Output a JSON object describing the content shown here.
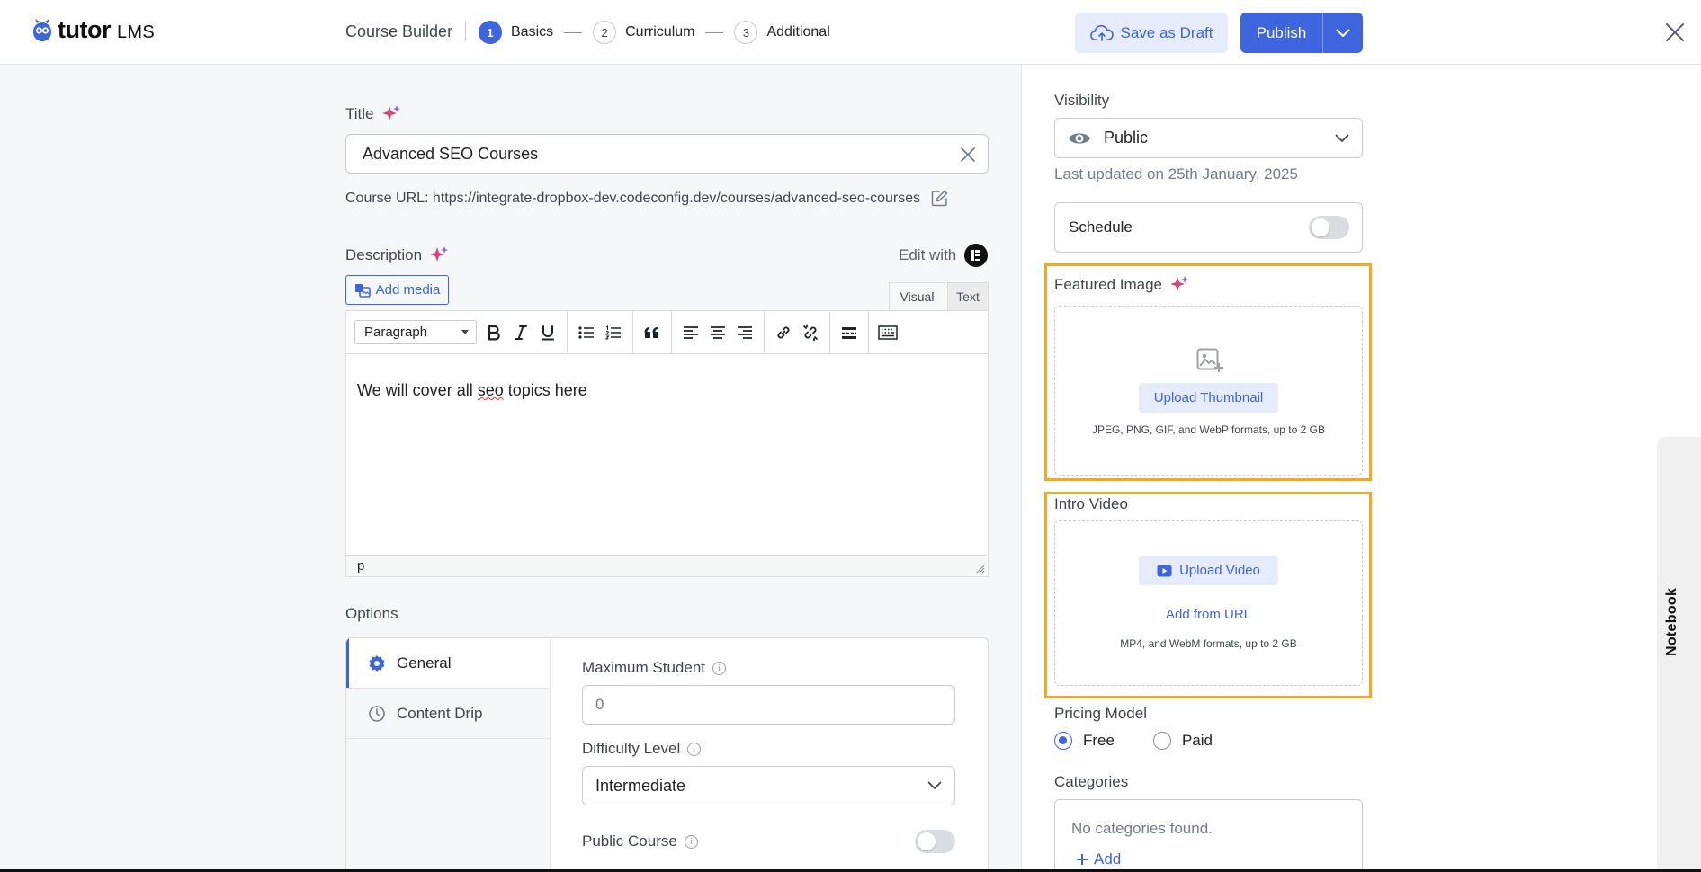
{
  "header": {
    "logo_main": "tutor",
    "logo_sub": "LMS",
    "builder_title": "Course Builder",
    "steps": [
      {
        "num": "1",
        "label": "Basics"
      },
      {
        "num": "2",
        "label": "Curriculum"
      },
      {
        "num": "3",
        "label": "Additional"
      }
    ],
    "save_draft_label": "Save as Draft",
    "publish_label": "Publish"
  },
  "basics": {
    "title_label": "Title",
    "title_value": "Advanced SEO Courses",
    "course_url": "Course URL: https://integrate-dropbox-dev.codeconfig.dev/courses/advanced-seo-courses",
    "description_label": "Description",
    "edit_with_label": "Edit with",
    "add_media_label": "Add media",
    "tab_visual": "Visual",
    "tab_text": "Text",
    "format_select": "Paragraph",
    "editor_text_before": "We will cover all ",
    "editor_text_misspelled": "seo",
    "editor_text_after": " topics here",
    "status_path": "p"
  },
  "options": {
    "heading": "Options",
    "tabs": [
      {
        "label": "General",
        "icon": "gear-icon"
      },
      {
        "label": "Content Drip",
        "icon": "clock-icon"
      }
    ],
    "max_students_label": "Maximum Student",
    "max_students_value": "0",
    "difficulty_label": "Difficulty Level",
    "difficulty_value": "Intermediate",
    "public_course_label": "Public Course"
  },
  "sidebar": {
    "visibility_label": "Visibility",
    "visibility_value": "Public",
    "last_updated": "Last updated on 25th January, 2025",
    "schedule_label": "Schedule",
    "featured_image_label": "Featured Image",
    "upload_thumbnail_label": "Upload Thumbnail",
    "thumbnail_hint": "JPEG, PNG, GIF, and WebP formats, up to 2 GB",
    "intro_video_label": "Intro Video",
    "upload_video_label": "Upload Video",
    "add_from_url_label": "Add from URL",
    "video_hint": "MP4, and WebM formats, up to 2 GB",
    "pricing_label": "Pricing Model",
    "pricing_free": "Free",
    "pricing_paid": "Paid",
    "pricing_selected": "Free",
    "categories_label": "Categories",
    "categories_empty": "No categories found.",
    "categories_add": "Add"
  },
  "notebook_label": "Notebook",
  "colors": {
    "accent": "#3e64de",
    "highlight": "#f5a623",
    "ai_sparkle": "#d6447a"
  }
}
